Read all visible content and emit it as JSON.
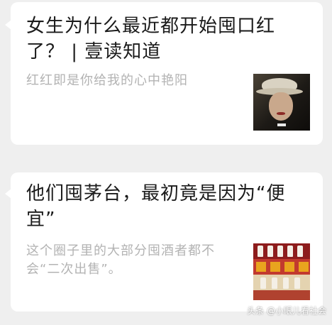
{
  "articles": [
    {
      "title": "女生为什么最近都开始囤口红了？ | 壹读知道",
      "summary": "红红即是你给我的心中艳阳",
      "thumbnail_icon": "movie-still-woman-hat"
    },
    {
      "title": "他们囤茅台，最初竟是因为“便宜”",
      "summary": "这个圈子里的大部分囤酒者都不会“二次出售”。",
      "thumbnail_icon": "liquor-shelf"
    }
  ],
  "watermark": "头条 @小眼儿看社会",
  "colors": {
    "background": "#efefef",
    "card": "#ffffff",
    "title_text": "#1a1a1a",
    "summary_text": "#b3b3b3"
  }
}
